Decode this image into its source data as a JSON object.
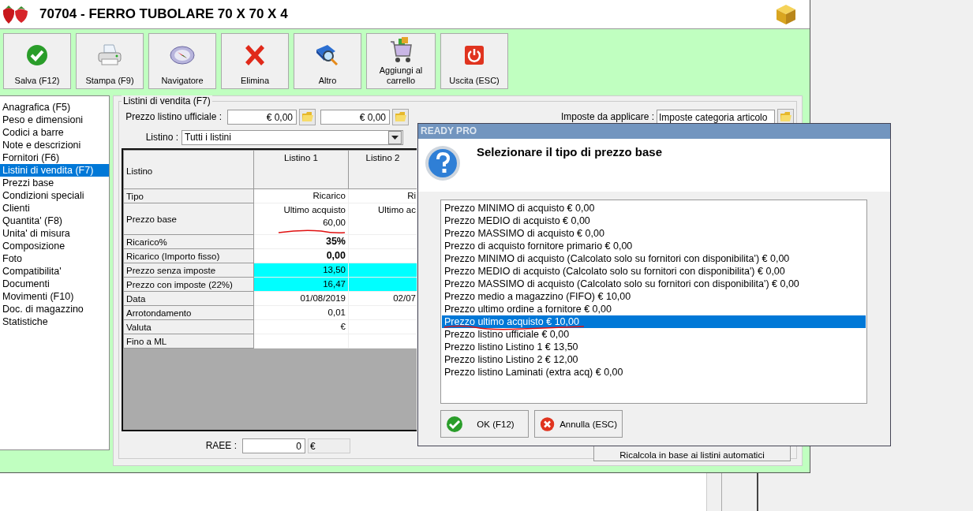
{
  "window": {
    "title": "70704 - FERRO TUBOLARE 70 X 70 X 4"
  },
  "toolbar": [
    {
      "label": "Salva (F12)",
      "kind": "check"
    },
    {
      "label": "Stampa (F9)",
      "kind": "printer"
    },
    {
      "label": "Navigatore",
      "kind": "compass"
    },
    {
      "label": "Elimina",
      "kind": "cross"
    },
    {
      "label": "Altro",
      "kind": "book"
    },
    {
      "label": "Aggiungi al carrello",
      "kind": "cart"
    },
    {
      "label": "Uscita (ESC)",
      "kind": "power"
    }
  ],
  "sidebar": {
    "items": [
      {
        "label": "Anagrafica (F5)",
        "selected": false
      },
      {
        "label": "Peso e dimensioni",
        "selected": false
      },
      {
        "label": "Codici a barre",
        "selected": false
      },
      {
        "label": "Note e descrizioni",
        "selected": false
      },
      {
        "label": "Fornitori (F6)",
        "selected": false
      },
      {
        "label": "Listini di vendita (F7)",
        "selected": true
      },
      {
        "label": "Prezzi base",
        "selected": false
      },
      {
        "label": "Condizioni speciali",
        "selected": false
      },
      {
        "label": "Clienti",
        "selected": false
      },
      {
        "label": "Quantita' (F8)",
        "selected": false
      },
      {
        "label": "Unita' di misura",
        "selected": false
      },
      {
        "label": "Composizione",
        "selected": false
      },
      {
        "label": "Foto",
        "selected": false
      },
      {
        "label": "Compatibilita'",
        "selected": false
      },
      {
        "label": "Documenti",
        "selected": false
      },
      {
        "label": "Movimenti (F10)",
        "selected": false
      },
      {
        "label": "Doc. di magazzino",
        "selected": false
      },
      {
        "label": "Statistiche",
        "selected": false
      }
    ]
  },
  "panel": {
    "legend": "Listini di vendita (F7)",
    "official_price": {
      "label": "Prezzo listino ufficiale :",
      "values": [
        "€ 0,00",
        "€ 0,00"
      ]
    },
    "taxes": {
      "label": "Imposte da applicare :",
      "value": "Imposte categoria articolo"
    },
    "price_list": {
      "label": "Listino :",
      "value": "Tutti i listini"
    },
    "table": {
      "columns": [
        "Listino",
        "Listino 1",
        "Listino 2"
      ],
      "rows": [
        {
          "bold": false,
          "highlighted": false,
          "underlined": false,
          "cells": [
            "Tipo",
            "Ricarico",
            "Ri"
          ]
        },
        {
          "bold": false,
          "highlighted": false,
          "underlined": true,
          "cells": [
            "Prezzo base",
            "Ultimo acquisto\n60,00",
            "Ultimo ac"
          ]
        },
        {
          "bold": true,
          "highlighted": false,
          "underlined": false,
          "cells": [
            "Ricarico%",
            "35%",
            ""
          ]
        },
        {
          "bold": true,
          "highlighted": false,
          "underlined": false,
          "cells": [
            "Ricarico (Importo fisso)",
            "0,00",
            ""
          ]
        },
        {
          "bold": false,
          "highlighted": true,
          "underlined": false,
          "cells": [
            "Prezzo senza imposte",
            "13,50",
            ""
          ]
        },
        {
          "bold": false,
          "highlighted": true,
          "underlined": false,
          "cells": [
            "Prezzo con imposte (22%)",
            "16,47",
            ""
          ]
        },
        {
          "bold": false,
          "highlighted": false,
          "underlined": false,
          "cells": [
            "Data",
            "01/08/2019",
            "02/07"
          ]
        },
        {
          "bold": false,
          "highlighted": false,
          "underlined": false,
          "cells": [
            "Arrotondamento",
            "0,01",
            ""
          ]
        },
        {
          "bold": false,
          "highlighted": false,
          "underlined": false,
          "cells": [
            "Valuta",
            "€",
            ""
          ]
        },
        {
          "highlighted": false,
          "underlined": false,
          "cells": [
            "Fino a ML",
            "",
            ""
          ]
        }
      ]
    },
    "raee": {
      "label": "RAEE :",
      "value": "0",
      "unit": "€"
    },
    "recalc_button": "Ricalcola in base ai listini automatici"
  },
  "dialog": {
    "title": "READY PRO",
    "heading": "Selezionare il tipo di prezzo base",
    "options": [
      {
        "label": "Prezzo MINIMO di acquisto € 0,00",
        "selected": false,
        "marked": false
      },
      {
        "label": "Prezzo MEDIO di acquisto € 0,00",
        "selected": false,
        "marked": false
      },
      {
        "label": "Prezzo MASSIMO di acquisto € 0,00",
        "selected": false,
        "marked": false
      },
      {
        "label": "Prezzo di acquisto fornitore primario € 0,00",
        "selected": false,
        "marked": false
      },
      {
        "label": "Prezzo MINIMO di acquisto (Calcolato solo su fornitori con disponibilita') € 0,00",
        "selected": false,
        "marked": false
      },
      {
        "label": "Prezzo MEDIO di acquisto (Calcolato solo su fornitori con disponibilita') € 0,00",
        "selected": false,
        "marked": false
      },
      {
        "label": "Prezzo MASSIMO di acquisto (Calcolato solo su fornitori con disponibilita') € 0,00",
        "selected": false,
        "marked": false
      },
      {
        "label": "Prezzo medio a magazzino (FIFO) € 10,00",
        "selected": false,
        "marked": false
      },
      {
        "label": "Prezzo ultimo ordine a fornitore € 0,00",
        "selected": false,
        "marked": false
      },
      {
        "label": "Prezzo ultimo acquisto € 10,00",
        "selected": true,
        "marked": true
      },
      {
        "label": "Prezzo listino ufficiale € 0,00",
        "selected": false,
        "marked": false
      },
      {
        "label": "Prezzo listino Listino 1 € 13,50",
        "selected": false,
        "marked": false
      },
      {
        "label": "Prezzo listino Listino 2 € 12,00",
        "selected": false,
        "marked": false
      },
      {
        "label": "Prezzo listino Laminati (extra acq) € 0,00",
        "selected": false,
        "marked": false
      }
    ],
    "buttons": [
      {
        "label": "OK (F12)",
        "kind": "ok"
      },
      {
        "label": "Annulla (ESC)",
        "kind": "cancel"
      }
    ]
  }
}
